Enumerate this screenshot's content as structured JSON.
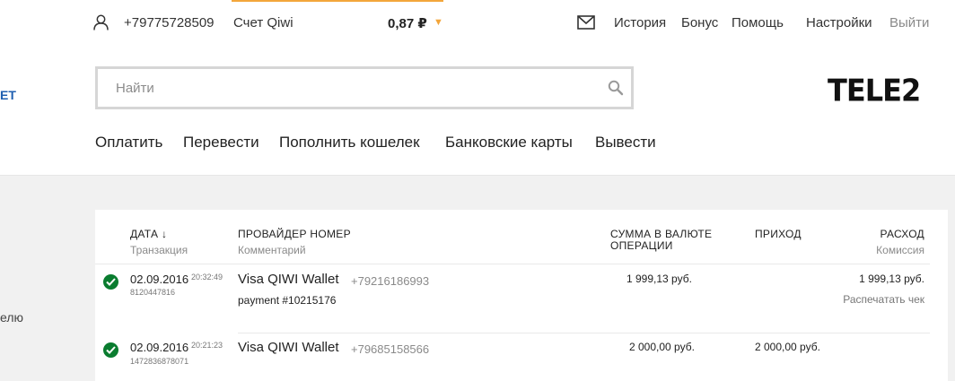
{
  "header": {
    "phone": "+79775728509",
    "account_label": "Счет Qiwi",
    "balance": "0,87 ₽",
    "balance_caret": "▼",
    "nav_right": [
      "История",
      "Бонус",
      "Помощь",
      "Настройки"
    ],
    "logout": "Выйти",
    "accent_color": "#f3a63b"
  },
  "left_fragments": [
    "ЕТ",
    "елю"
  ],
  "search": {
    "placeholder": "Найти",
    "value": ""
  },
  "logo": "TELE2",
  "main_nav": [
    "Оплатить",
    "Перевести",
    "Пополнить кошелек",
    "Банковские карты",
    "Вывести"
  ],
  "table": {
    "headers": {
      "date": "ДАТА ↓",
      "date_sub": "Транзакция",
      "provider": "ПРОВАЙДЕР НОМЕР",
      "provider_sub": "Комментарий",
      "amount_line1": "СУММА В ВАЛЮТЕ",
      "amount_line2": "ОПЕРАЦИИ",
      "income": "ПРИХОД",
      "expense": "РАСХОД",
      "expense_sub": "Комиссия"
    },
    "rows": [
      {
        "date": "02.09.2016",
        "time": "20:32:49",
        "transaction": "8120447816",
        "provider": "Visa QIWI Wallet",
        "number": "+79216186993",
        "comment": "payment #10215176",
        "amount": "1 999,13 руб.",
        "income": "",
        "expense": "1 999,13 руб.",
        "action": "Распечатать чек"
      },
      {
        "date": "02.09.2016",
        "time": "20:21:23",
        "transaction": "1472836878071",
        "provider": "Visa QIWI Wallet",
        "number": "+79685158566",
        "comment": "",
        "amount": "2 000,00 руб.",
        "income": "2 000,00 руб.",
        "expense": "",
        "action": ""
      }
    ],
    "status_color": "#0a7c2f"
  }
}
